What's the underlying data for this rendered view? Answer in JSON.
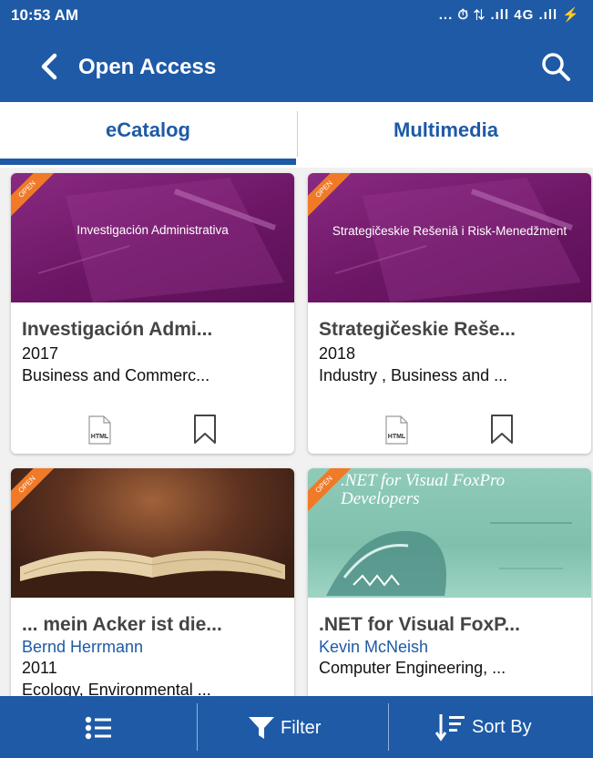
{
  "status_bar": {
    "time": "10:53 AM",
    "icons": "... ⏱ ⇅ .ıll 4G .ıll ⚡"
  },
  "header": {
    "title": "Open Access"
  },
  "tabs": [
    {
      "label": "eCatalog"
    },
    {
      "label": "Multimedia"
    }
  ],
  "cards": [
    {
      "badge": "OPEN",
      "cover_text": "Investigación Administrativa",
      "title": "Investigación Admi...",
      "author": "",
      "year": "2017",
      "subject": "Business and Commerc...",
      "format_icon": "HTML"
    },
    {
      "badge": "OPEN",
      "cover_text": "Strategičeskie Rešeniâ i Risk-Menedžment",
      "title": "Strategičeskie Reše...",
      "author": "",
      "year": "2018",
      "subject": "Industry , Business and ...",
      "format_icon": "HTML"
    },
    {
      "badge": "OPEN",
      "cover_text": "",
      "title": "... mein Acker ist die...",
      "author": "Bernd Herrmann",
      "year": "2011",
      "subject": "Ecology, Environmental ..."
    },
    {
      "badge": "OPEN",
      "cover_text": ".NET for Visual FoxPro Developers",
      "title": ".NET for Visual FoxP...",
      "author": "Kevin McNeish",
      "year": "",
      "subject": "Computer Engineering, ..."
    }
  ],
  "bottom_bar": {
    "filter_label": "Filter",
    "sort_label": "Sort By"
  },
  "colors": {
    "primary": "#1e5aa6",
    "ribbon": "#f07a27",
    "cover_purple": "#7a1e74"
  }
}
